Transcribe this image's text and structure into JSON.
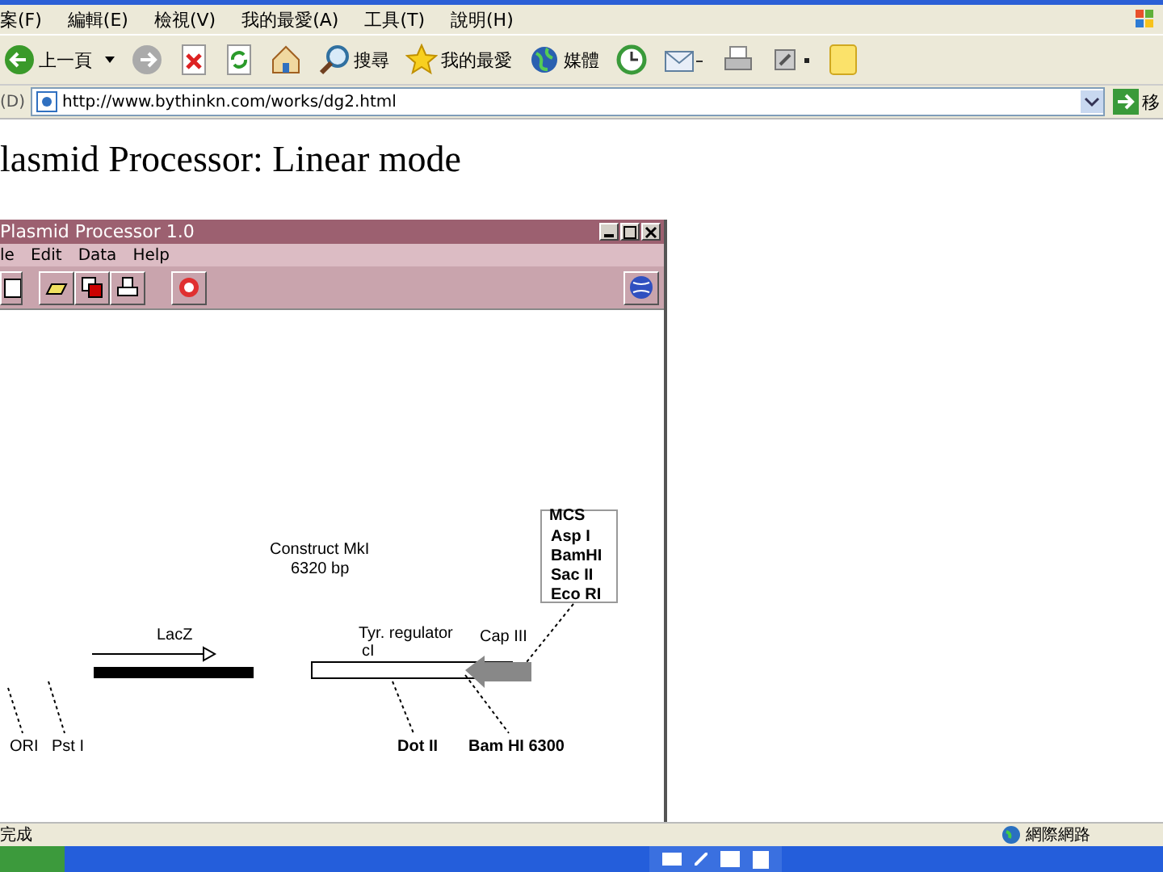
{
  "browser": {
    "menu": [
      "案(F)",
      "編輯(E)",
      "檢視(V)",
      "我的最愛(A)",
      "工具(T)",
      "說明(H)"
    ],
    "toolbar": [
      {
        "kind": "back",
        "label": "上一頁"
      },
      {
        "kind": "forward"
      },
      {
        "kind": "stop"
      },
      {
        "kind": "refresh"
      },
      {
        "kind": "home"
      },
      {
        "kind": "search",
        "label": "搜尋"
      },
      {
        "kind": "favorites",
        "label": "我的最愛"
      },
      {
        "kind": "media",
        "label": "媒體"
      },
      {
        "kind": "history"
      },
      {
        "kind": "mail"
      },
      {
        "kind": "print"
      },
      {
        "kind": "edit"
      },
      {
        "kind": "note"
      }
    ],
    "address_label": "(D)",
    "url": "http://www.bythinkn.com/works/dg2.html",
    "go_label": "移"
  },
  "page": {
    "heading": "lasmid Processor: Linear mode",
    "app": {
      "title": "Plasmid Processor 1.0",
      "menu": [
        "le",
        "Edit",
        "Data",
        "Help"
      ],
      "diagram": {
        "name": "Construct MkI",
        "length": "6320 bp",
        "mcs": {
          "title": "MCS",
          "sites": [
            "Asp I",
            "BamHI",
            "Sac II",
            "Eco RI"
          ]
        },
        "features": [
          {
            "kind": "gene",
            "label": "LacZ"
          },
          {
            "kind": "regulator",
            "label": "Tyr. regulator",
            "sub": "cI"
          },
          {
            "kind": "promoter",
            "label": "Cap III"
          }
        ],
        "sites": [
          "ORI",
          "Pst I",
          "Dot II",
          "Bam HI 6300"
        ]
      }
    }
  },
  "status_bar": {
    "left": "完成",
    "right": "網際網路"
  }
}
